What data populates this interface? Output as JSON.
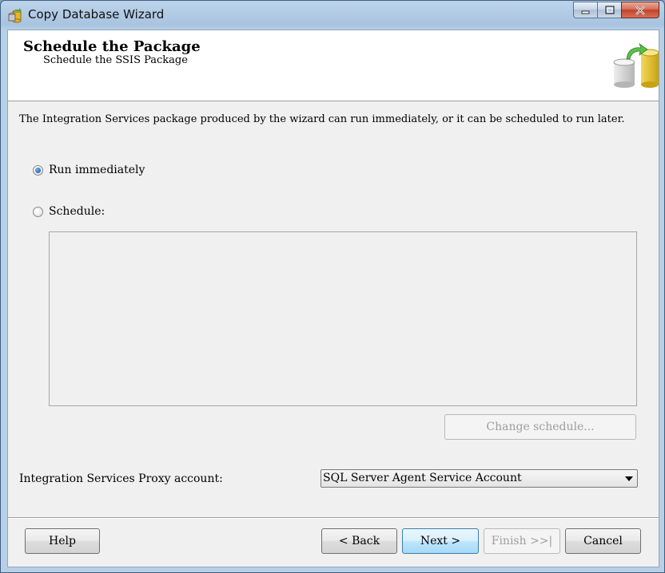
{
  "window": {
    "title": "Copy Database Wizard"
  },
  "header": {
    "title": "Schedule the Package",
    "subtitle": "Schedule the SSIS Package"
  },
  "description": "The Integration Services package produced by the wizard can run immediately, or it can be scheduled to run later.",
  "options": {
    "run_now": {
      "label": "Run immediately",
      "checked": true
    },
    "schedule": {
      "label": "Schedule:",
      "checked": false
    }
  },
  "change_schedule_label": "Change schedule...",
  "proxy": {
    "label": "Integration Services Proxy account:",
    "value": "SQL Server Agent Service Account"
  },
  "buttons": {
    "help": "Help",
    "back": "< Back",
    "next": "Next >",
    "finish": "Finish >>|",
    "cancel": "Cancel"
  },
  "colors": {
    "titlebar": "#b8cfe6",
    "client_bg": "#f0f0f0",
    "default_button": "#bee6fd",
    "close_button": "#c4412a"
  }
}
